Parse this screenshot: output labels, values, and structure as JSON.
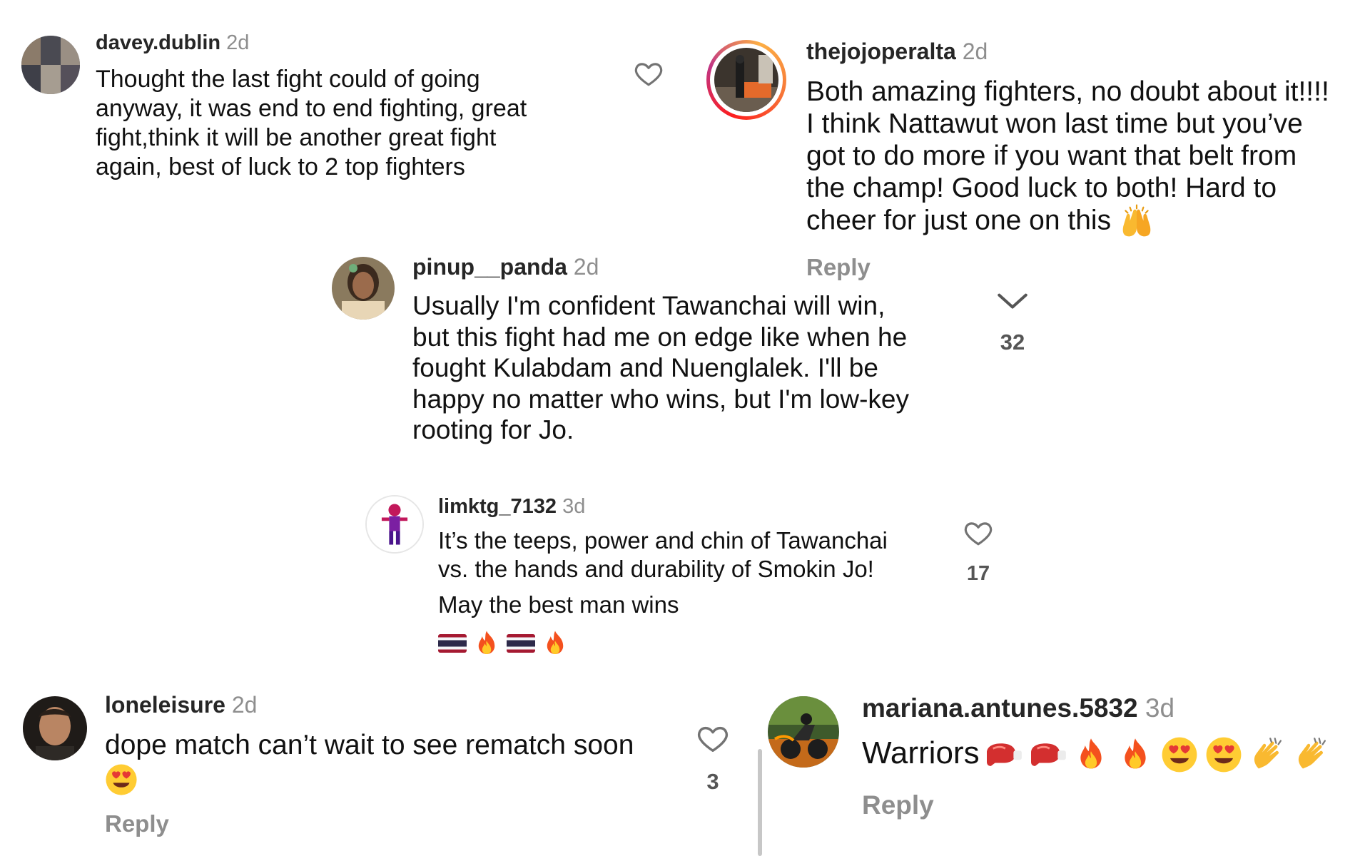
{
  "comments": [
    {
      "username": "davey.dublin",
      "time": "2d",
      "lines": [
        "Thought the last fight could of going",
        "anyway, it was end to end fighting, great",
        "fight,think it will be another great fight",
        "again, best of luck to 2 top fighters"
      ]
    },
    {
      "username": "thejojoperalta",
      "time": "2d",
      "lines": [
        "Both amazing fighters, no doubt about it!!!!",
        "I think Nattawut won last time but you’ve",
        "got to do more if you want that belt from",
        "the champ! Good luck to both! Hard to",
        "cheer for just one on this"
      ],
      "reply_label": "Reply"
    },
    {
      "username": "pinup__panda",
      "time": "2d",
      "lines": [
        "Usually I'm confident Tawanchai will win,",
        "but this fight had me on edge like when he",
        "fought Kulabdam and Nuenglalek.  I'll be",
        "happy no matter who wins, but I'm low-key",
        "rooting for Jo."
      ],
      "count": "32"
    },
    {
      "username": "limktg_7132",
      "time": "3d",
      "lines": [
        "It’s the teeps, power and chin of Tawanchai",
        "vs. the hands and durability of Smokin Jo!"
      ],
      "extra_line": "May the best man wins",
      "count": "17"
    },
    {
      "username": "loneleisure",
      "time": "2d",
      "lines": [
        "dope match can’t wait to see rematch soon"
      ],
      "count": "3",
      "reply_label": "Reply"
    },
    {
      "username": "mariana.antunes.5832",
      "time": "3d",
      "text": "Warriors",
      "reply_label": "Reply"
    }
  ],
  "icons": {
    "like": "heart-icon",
    "expand": "chevron-down-icon",
    "emoji_raised_hands": "raised-hands-emoji",
    "emoji_fire": "fire-emoji",
    "emoji_heart_eyes": "heart-eyes-emoji",
    "emoji_boxing_glove": "boxing-glove-emoji",
    "emoji_clap": "clapping-hands-emoji",
    "flag_thailand": "thailand-flag-emoji"
  },
  "colors": {
    "username": "#262626",
    "meta": "#8e8e8e",
    "story_ring_start": "#fd1d1d",
    "story_ring_end": "#fcaf45"
  }
}
